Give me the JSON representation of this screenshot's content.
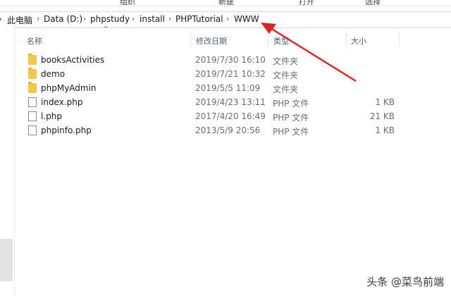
{
  "ribbon": {
    "groups": [
      "组织",
      "新建",
      "打开",
      "选择"
    ]
  },
  "address": {
    "crumbs": [
      "此电脑",
      "Data (D:)",
      "phpstudy",
      "install",
      "PHPTutorial",
      "WWW"
    ]
  },
  "columns": {
    "name": "名称",
    "date": "修改日期",
    "type": "类型",
    "size": "大小"
  },
  "files": [
    {
      "name": "booksActivities",
      "date": "2019/7/30 16:10",
      "type": "文件夹",
      "size": "",
      "icon": "folder-icon"
    },
    {
      "name": "demo",
      "date": "2019/7/21 10:32",
      "type": "文件夹",
      "size": "",
      "icon": "folder-icon"
    },
    {
      "name": "phpMyAdmin",
      "date": "2019/5/5 11:09",
      "type": "文件夹",
      "size": "",
      "icon": "folder-icon"
    },
    {
      "name": "index.php",
      "date": "2019/4/23 13:11",
      "type": "PHP 文件",
      "size": "1 KB",
      "icon": "file-icon"
    },
    {
      "name": "l.php",
      "date": "2017/4/20 16:49",
      "type": "PHP 文件",
      "size": "21 KB",
      "icon": "file-icon"
    },
    {
      "name": "phpinfo.php",
      "date": "2013/5/9 20:56",
      "type": "PHP 文件",
      "size": "1 KB",
      "icon": "file-icon"
    }
  ],
  "watermark": "头条 @菜鸟前端",
  "colors": {
    "annotation_arrow": "#e02020",
    "folder": "#f2c84b"
  }
}
